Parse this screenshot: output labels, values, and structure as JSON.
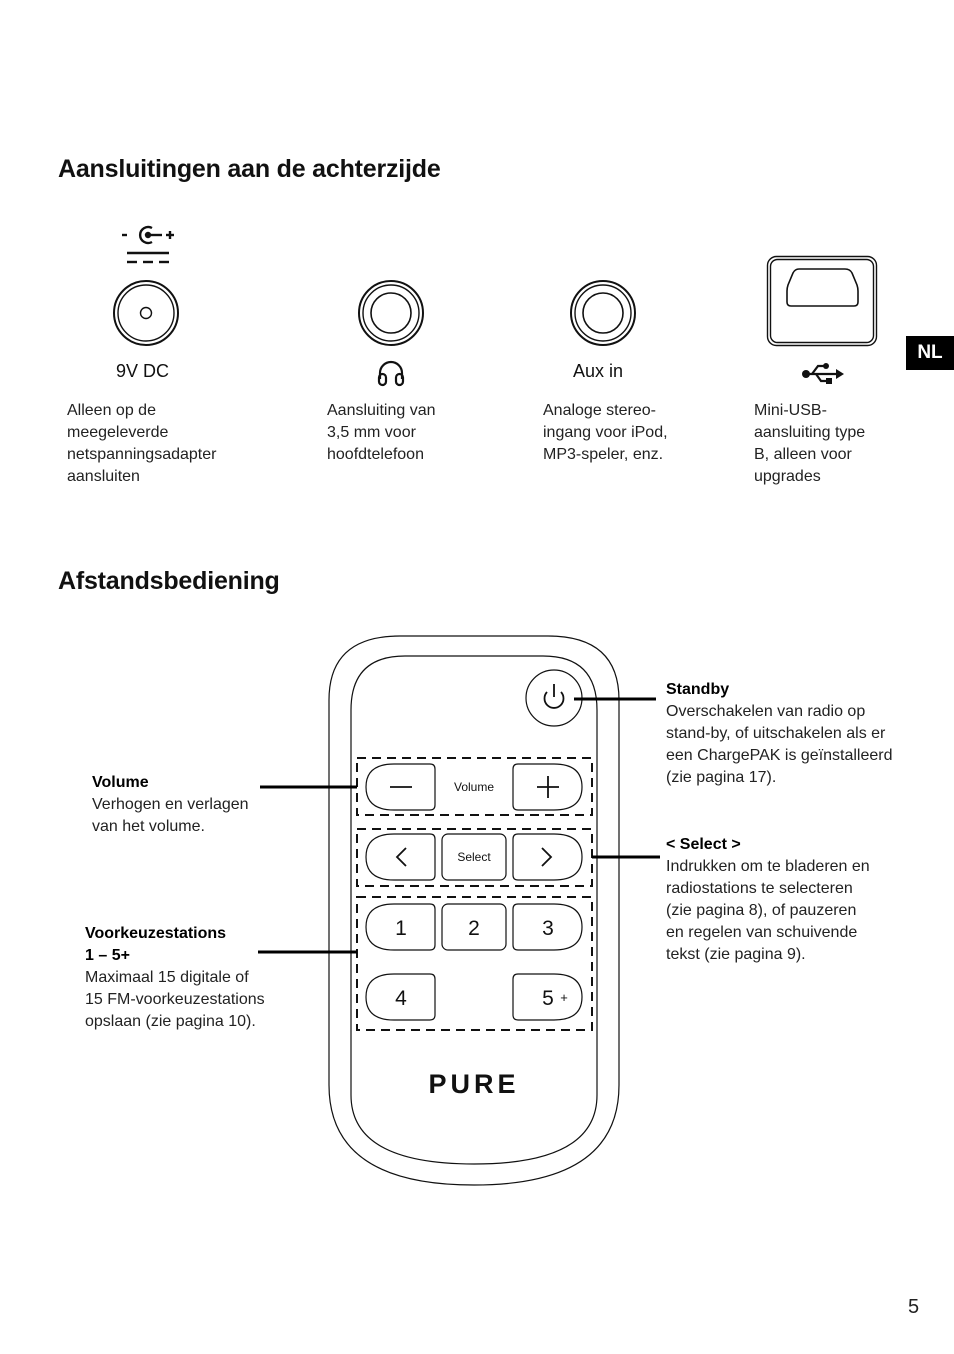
{
  "section1": {
    "title": "Aansluitingen aan de achterzijde",
    "connectors": [
      {
        "icon": "dc-power-jack",
        "label": "9V DC",
        "polarity_symbol": "- ◐ +",
        "description": "Alleen op de\nmeegeleverde\nnetspanningsadapter\naansluiten"
      },
      {
        "icon": "headphone-jack",
        "label_icon": "headphones-icon",
        "description": "Aansluiting van\n3,5 mm voor\nhoofdtelefoon"
      },
      {
        "icon": "aux-jack",
        "label": "Aux in",
        "description": "Analoge stereo-\ningang voor iPod,\nMP3-speler, enz."
      },
      {
        "icon": "mini-usb-port",
        "label_icon": "usb-icon",
        "description": "Mini-USB-\naansluiting type\nB, alleen voor\nupgrades"
      }
    ]
  },
  "language_badge": "NL",
  "section2": {
    "title": "Afstandsbediening",
    "remote": {
      "brand": "PURE",
      "buttons": {
        "standby": "power",
        "volume_down": "−",
        "volume_label": "Volume",
        "volume_up": "+",
        "prev": "<",
        "select": "Select",
        "next": ">",
        "preset1": "1",
        "preset2": "2",
        "preset3": "3",
        "preset4": "4",
        "preset5": "5",
        "preset5_plus": "+"
      }
    },
    "callouts": {
      "volume": {
        "title": "Volume",
        "text": "Verhogen en verlagen\nvan het volume."
      },
      "presets": {
        "title": "Voorkeuzestations\n1 – 5+",
        "text": "Maximaal 15 digitale of\n15 FM-voorkeuzestations\nopslaan (zie pagina 10)."
      },
      "standby": {
        "title": "Standby",
        "text": "Overschakelen van radio op\nstand-by, of uitschakelen als er\neen ChargePAK is geïnstalleerd\n(zie pagina 17)."
      },
      "select": {
        "title": "< Select >",
        "text": "Indrukken om te bladeren en\nradiostations te selecteren\n(zie pagina 8), of pauzeren\nen regelen van schuivende\ntekst (zie pagina 9)."
      }
    }
  },
  "page_number": "5"
}
